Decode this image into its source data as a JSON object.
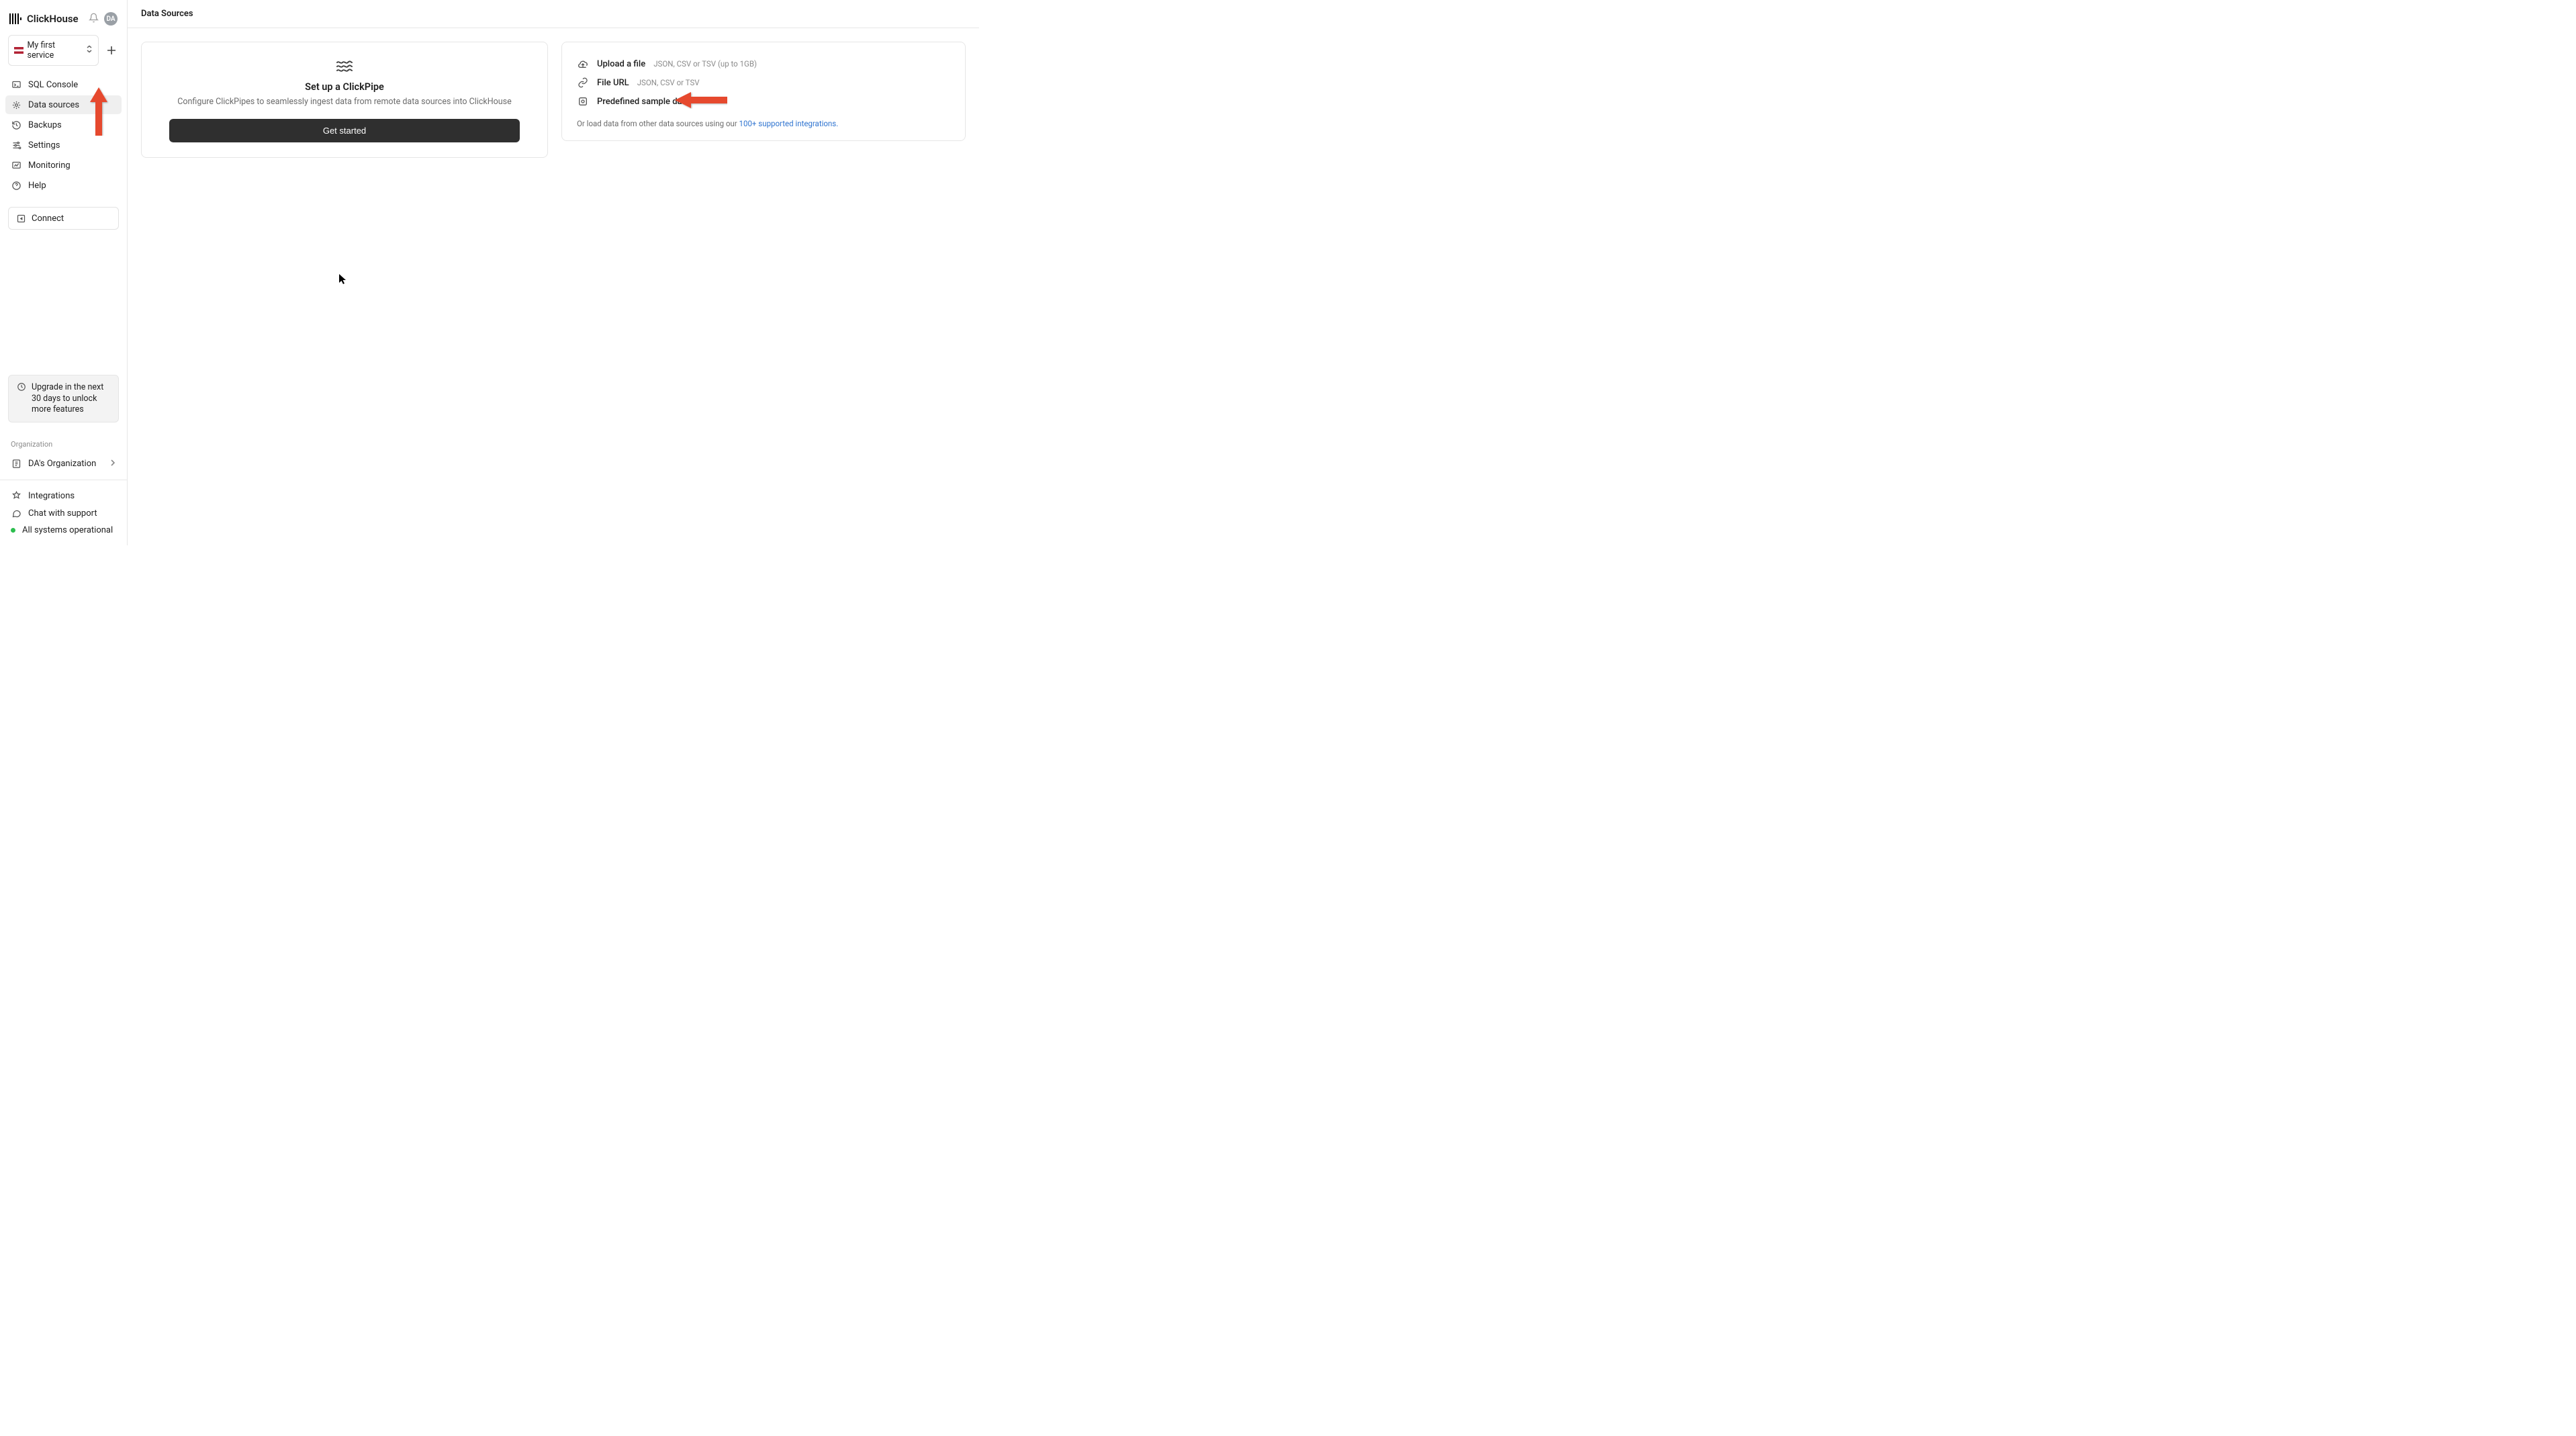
{
  "brand": {
    "name": "ClickHouse",
    "avatar": "DA"
  },
  "service": {
    "name": "My first service"
  },
  "nav": {
    "sql_console": "SQL Console",
    "data_sources": "Data sources",
    "backups": "Backups",
    "settings": "Settings",
    "monitoring": "Monitoring",
    "help": "Help",
    "connect": "Connect"
  },
  "upgrade": {
    "text": "Upgrade in the next 30 days to unlock more features"
  },
  "org": {
    "label": "Organization",
    "name": "DA's Organization"
  },
  "footer": {
    "integrations": "Integrations",
    "chat": "Chat with support",
    "status": "All systems operational"
  },
  "header": {
    "title": "Data Sources"
  },
  "clickpipe": {
    "title": "Set up a ClickPipe",
    "subtitle": "Configure ClickPipes to seamlessly ingest data from remote data sources into ClickHouse",
    "button": "Get started"
  },
  "sources": {
    "upload": {
      "title": "Upload a file",
      "hint": "JSON, CSV or TSV (up to 1GB)"
    },
    "url": {
      "title": "File URL",
      "hint": "JSON, CSV or TSV"
    },
    "sample": {
      "title": "Predefined sample data"
    },
    "footer_prefix": "Or load data from other data sources using our ",
    "footer_link": "100+ supported integrations."
  }
}
